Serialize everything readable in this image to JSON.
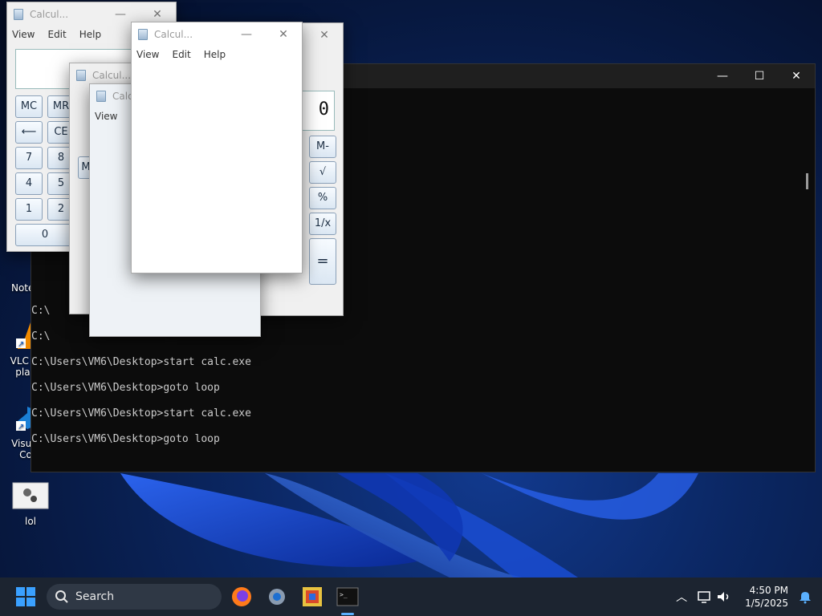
{
  "calc": {
    "title": "Calcul...",
    "title_short": "Calc",
    "menu": {
      "view": "View",
      "edit": "Edit",
      "help": "Help"
    },
    "display_value": "0",
    "buttons": {
      "mc": "MC",
      "mr": "MR",
      "back": "⟵",
      "ce": "CE",
      "seven": "7",
      "eight": "8",
      "four": "4",
      "five": "5",
      "one": "1",
      "two": "2",
      "zero": "0",
      "mminus": "M-",
      "sqrt": "√",
      "percent": "%",
      "recip": "1/x",
      "equals": "=",
      "m_partial": "M"
    }
  },
  "window_controls": {
    "minimize": "—",
    "maximize": "☐",
    "close": "✕"
  },
  "terminal": {
    "lines": [
      "C:\\",
      "C:\\",
      "C:\\Users\\VM6\\Desktop>start calc.exe",
      "C:\\Users\\VM6\\Desktop>goto loop",
      "C:\\Users\\VM6\\Desktop>start calc.exe",
      "C:\\Users\\VM6\\Desktop>goto loop"
    ]
  },
  "desktop_icons": [
    {
      "label": "Notep"
    },
    {
      "label": "VLC m\nplay"
    },
    {
      "label": "Visual\nCo"
    },
    {
      "label": "lol"
    }
  ],
  "taskbar": {
    "search_placeholder": "Search",
    "time": "4:50 PM",
    "date": "1/5/2025"
  }
}
